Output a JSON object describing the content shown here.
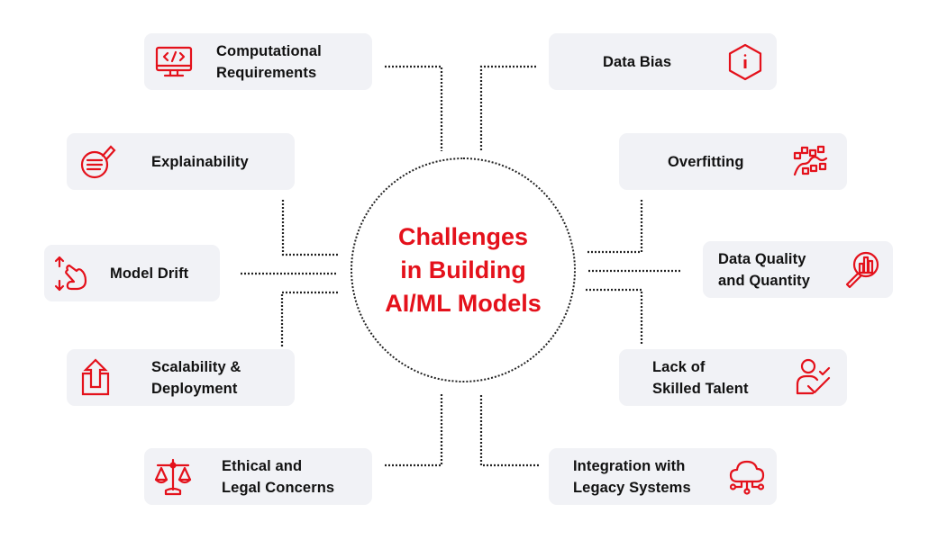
{
  "diagram": {
    "title_lines": [
      "Challenges",
      "in Building",
      "AI/ML Models"
    ],
    "accent_color": "#e4111b",
    "card_background": "#f1f2f6",
    "connector_color": "#222222"
  },
  "challenges": [
    {
      "id": "computational-requirements",
      "label_lines": [
        "Computational",
        "Requirements"
      ],
      "icon": "computer-code-icon",
      "side": "left"
    },
    {
      "id": "data-bias",
      "label_lines": [
        "Data Bias"
      ],
      "icon": "hexagon-info-icon",
      "side": "right"
    },
    {
      "id": "explainability",
      "label_lines": [
        "Explainability"
      ],
      "icon": "document-search-icon",
      "side": "left"
    },
    {
      "id": "overfitting",
      "label_lines": [
        "Overfitting"
      ],
      "icon": "scatter-curve-icon",
      "side": "right"
    },
    {
      "id": "model-drift",
      "label_lines": [
        "Model Drift"
      ],
      "icon": "hand-swipe-icon",
      "side": "left"
    },
    {
      "id": "data-quality",
      "label_lines": [
        "Data Quality",
        "and Quantity"
      ],
      "icon": "magnifier-chart-icon",
      "side": "right"
    },
    {
      "id": "scalability",
      "label_lines": [
        "Scalability &",
        "Deployment"
      ],
      "icon": "upload-box-icon",
      "side": "left"
    },
    {
      "id": "skilled-talent",
      "label_lines": [
        "Lack of",
        "Skilled Talent"
      ],
      "icon": "person-check-icon",
      "side": "right"
    },
    {
      "id": "ethical-legal",
      "label_lines": [
        "Ethical and",
        "Legal Concerns"
      ],
      "icon": "scales-icon",
      "side": "left"
    },
    {
      "id": "legacy-integration",
      "label_lines": [
        "Integration with",
        "Legacy Systems"
      ],
      "icon": "cloud-network-icon",
      "side": "right"
    }
  ]
}
